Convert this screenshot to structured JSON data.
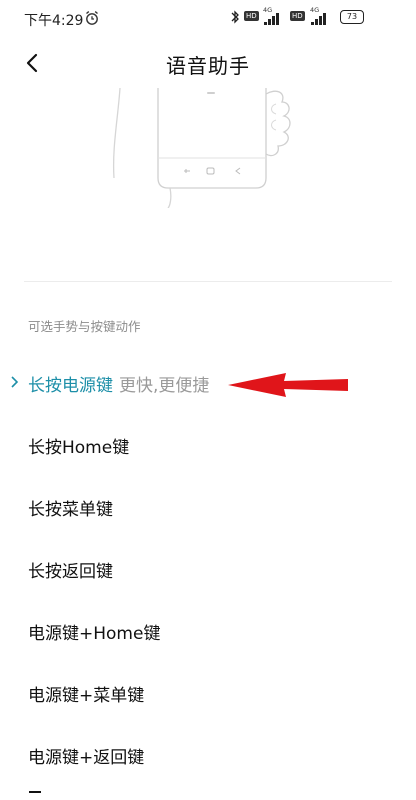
{
  "status_bar": {
    "time": "下午4:29",
    "hd_label": "HD",
    "network_1": "4G",
    "network_2": "4G",
    "battery": "73"
  },
  "header": {
    "title": "语音助手"
  },
  "section": {
    "label": "可选手势与按键动作"
  },
  "options": [
    {
      "label": "长按电源键",
      "hint": "更快,更便捷",
      "selected": true
    },
    {
      "label": "长按Home键"
    },
    {
      "label": "长按菜单键"
    },
    {
      "label": "长按返回键"
    },
    {
      "label": "电源键+Home键"
    },
    {
      "label": "电源键+菜单键"
    },
    {
      "label": "电源键+返回键"
    }
  ],
  "colors": {
    "accent": "#1d8fa8",
    "annotation_arrow": "#e0151a"
  }
}
